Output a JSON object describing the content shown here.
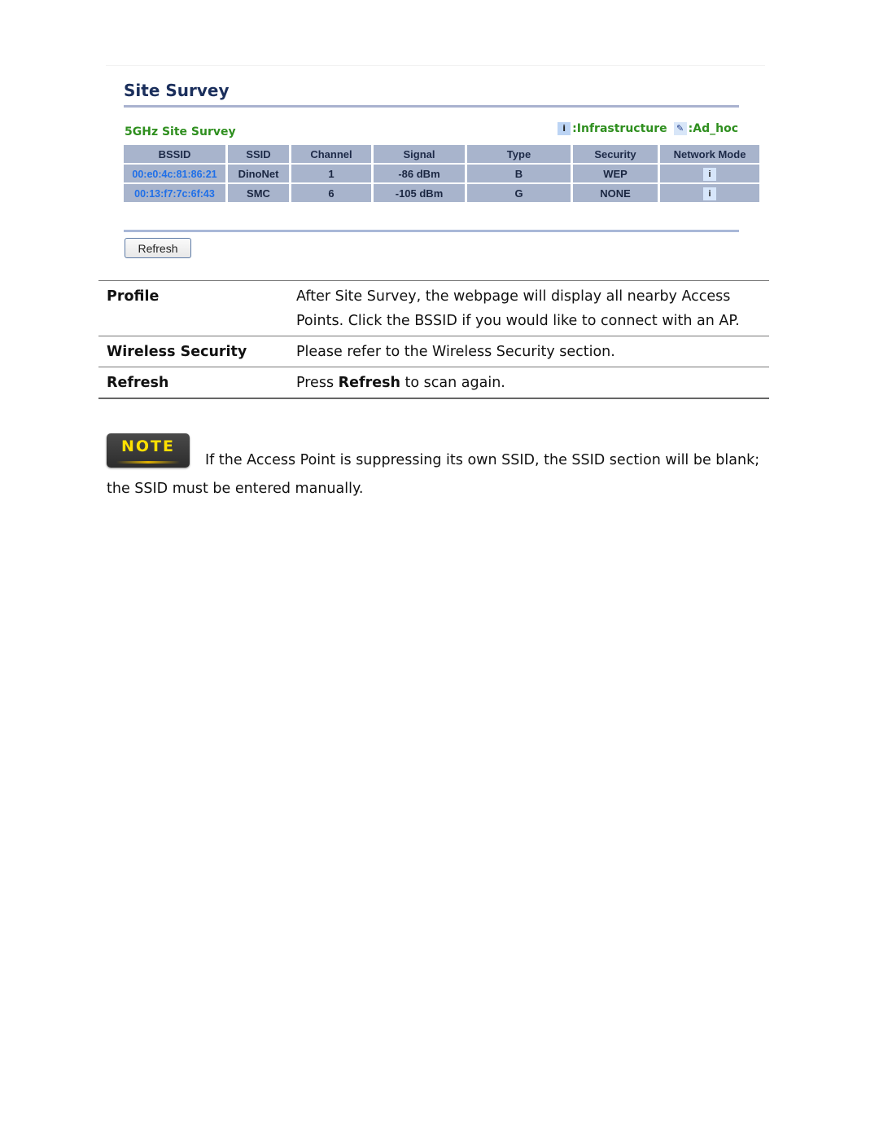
{
  "screenshot": {
    "title": "Site Survey",
    "subtitle": "5GHz Site Survey",
    "legend": [
      {
        "icon": "infrastructure-icon",
        "glyph": "i",
        "label": ":Infrastructure"
      },
      {
        "icon": "adhoc-icon",
        "glyph": "✎",
        "label": ":Ad_hoc"
      }
    ],
    "columns": [
      "BSSID",
      "SSID",
      "Channel",
      "Signal",
      "Type",
      "Security",
      "Network Mode"
    ],
    "rows": [
      {
        "bssid": "00:e0:4c:81:86:21",
        "ssid": "DinoNet",
        "channel": "1",
        "signal": "-86 dBm",
        "type": "B",
        "security": "WEP",
        "mode_glyph": "i",
        "mode": "infrastructure"
      },
      {
        "bssid": "00:13:f7:7c:6f:43",
        "ssid": "SMC",
        "channel": "6",
        "signal": "-105 dBm",
        "type": "G",
        "security": "NONE",
        "mode_glyph": "i",
        "mode": "infrastructure"
      }
    ],
    "refresh_label": "Refresh"
  },
  "descriptions": [
    {
      "key": "Profile",
      "value": "After Site Survey, the webpage will display all nearby Access Points. Click the BSSID if you would like to connect with an AP."
    },
    {
      "key": "Wireless Security",
      "value": "Please refer to the Wireless Security section."
    },
    {
      "key": "Refresh",
      "value_pre": "Press ",
      "value_bold": "Refresh",
      "value_post": " to scan again."
    }
  ],
  "note": {
    "badge": "NOTE",
    "line1": "If the Access Point is suppressing its own SSID, the SSID section will be blank;",
    "line2": "the SSID must be entered manually."
  }
}
